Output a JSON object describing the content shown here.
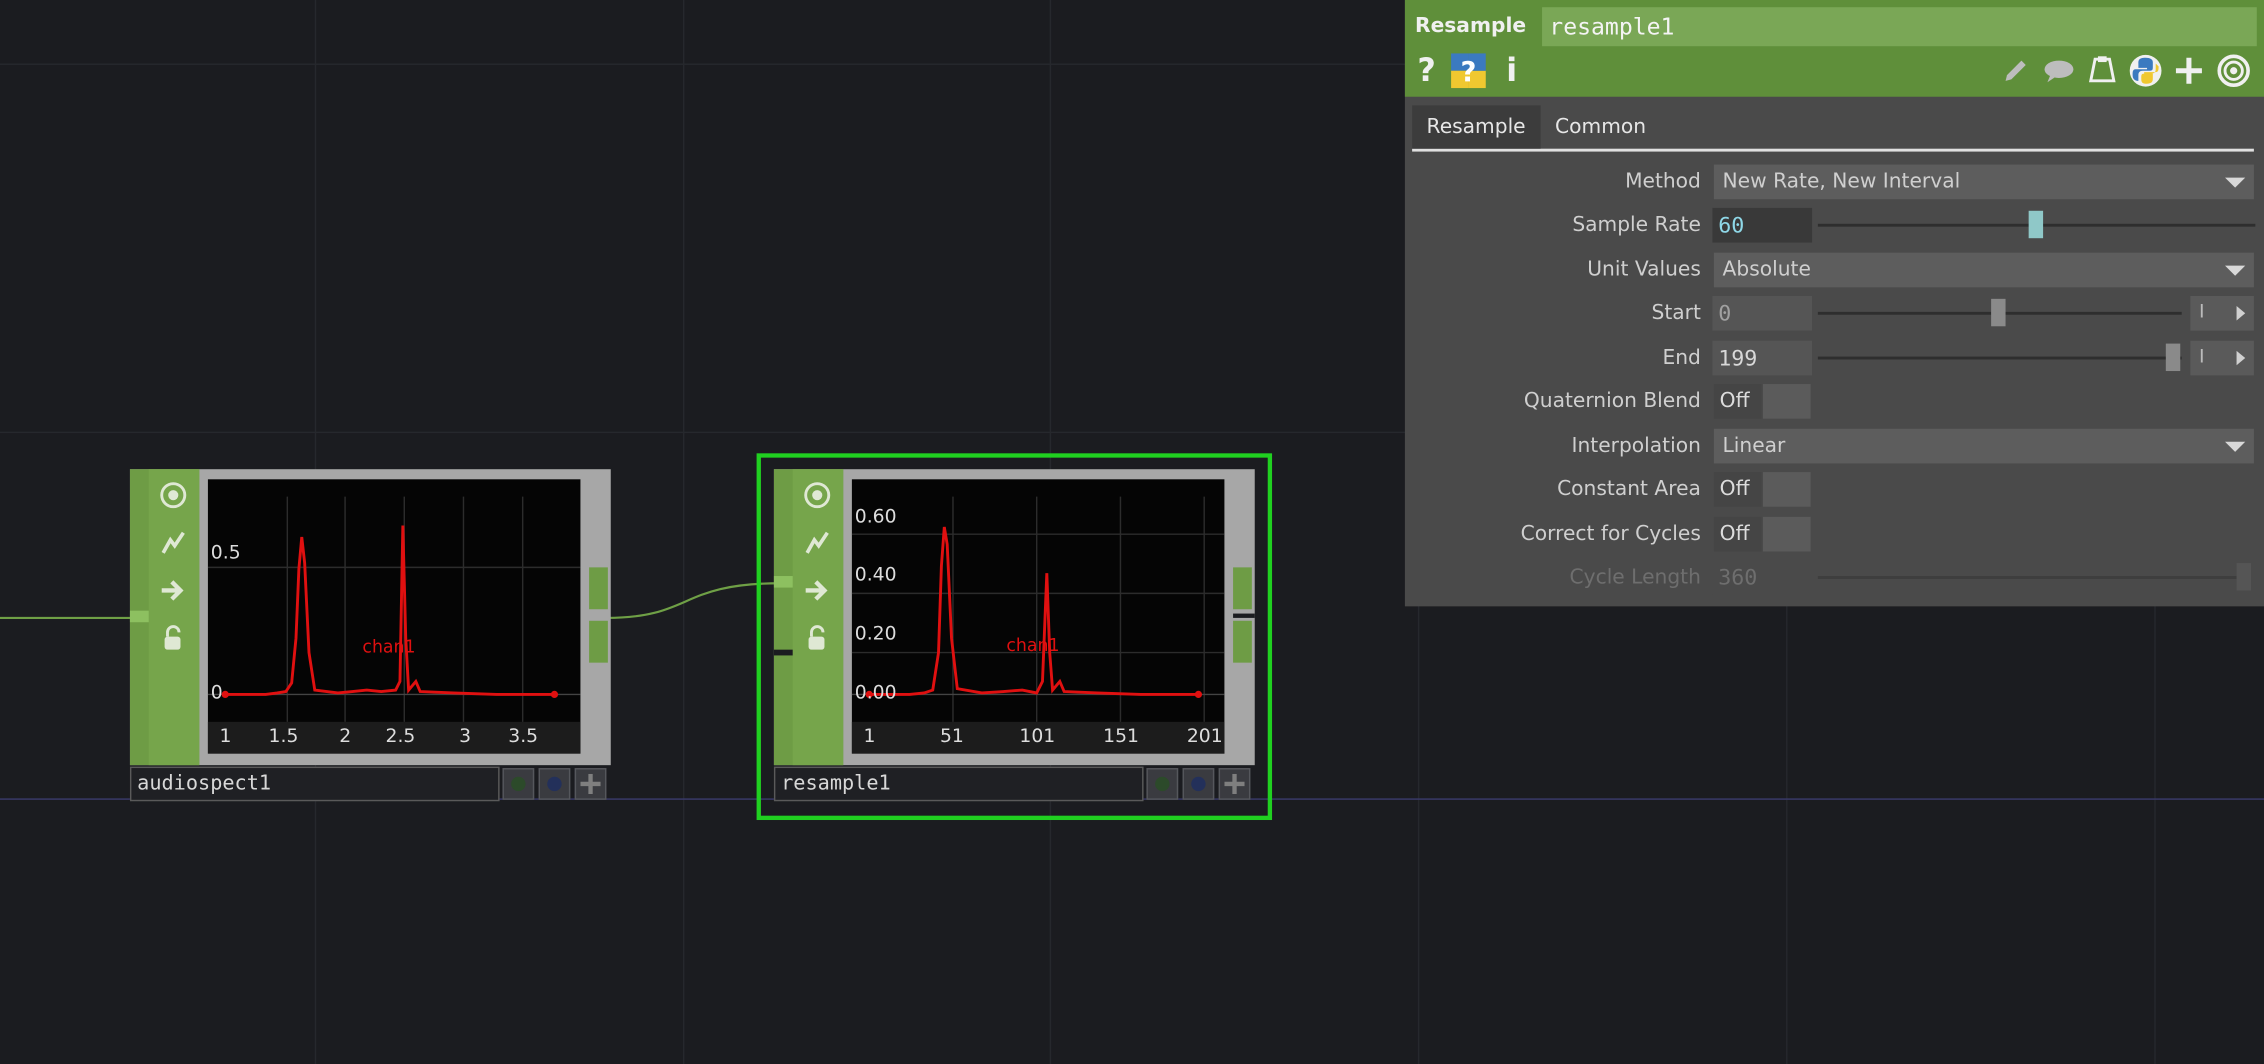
{
  "network": {
    "nodes": [
      {
        "name": "audiospect1",
        "channel": "chan1",
        "y_ticks": [
          "0.5",
          "0"
        ],
        "x_ticks": [
          "1",
          "1.5",
          "2",
          "2.5",
          "3",
          "3.5"
        ]
      },
      {
        "name": "resample1",
        "channel": "chan1",
        "y_ticks": [
          "0.60",
          "0.40",
          "0.20",
          "0.00"
        ],
        "x_ticks": [
          "1",
          "51",
          "101",
          "151",
          "201"
        ]
      }
    ]
  },
  "panel": {
    "op_type": "Resample",
    "op_name": "resample1",
    "header_icons": [
      "help-icon",
      "python-help-icon",
      "info-icon",
      "pencil-icon",
      "comment-icon",
      "clipboard-icon",
      "python-icon",
      "plus-icon",
      "viewer-icon"
    ],
    "tabs": [
      "Resample",
      "Common"
    ],
    "active_tab": "Resample",
    "params": {
      "method": {
        "label": "Method",
        "value": "New Rate, New Interval"
      },
      "sample_rate": {
        "label": "Sample Rate",
        "value": "60"
      },
      "unit_values": {
        "label": "Unit Values",
        "value": "Absolute"
      },
      "start": {
        "label": "Start",
        "value": "0",
        "unit": "I"
      },
      "end": {
        "label": "End",
        "value": "199",
        "unit": "I"
      },
      "quaternion_blend": {
        "label": "Quaternion Blend",
        "value": "Off"
      },
      "interpolation": {
        "label": "Interpolation",
        "value": "Linear"
      },
      "constant_area": {
        "label": "Constant Area",
        "value": "Off"
      },
      "correct_for_cycles": {
        "label": "Correct for Cycles",
        "value": "Off"
      },
      "cycle_length": {
        "label": "Cycle Length",
        "value": "360"
      }
    }
  },
  "colors": {
    "accent_green": "#5f8f3a",
    "selection_green": "#20d020",
    "plot_red": "#e01010",
    "number_cyan": "#8fd8e8"
  }
}
